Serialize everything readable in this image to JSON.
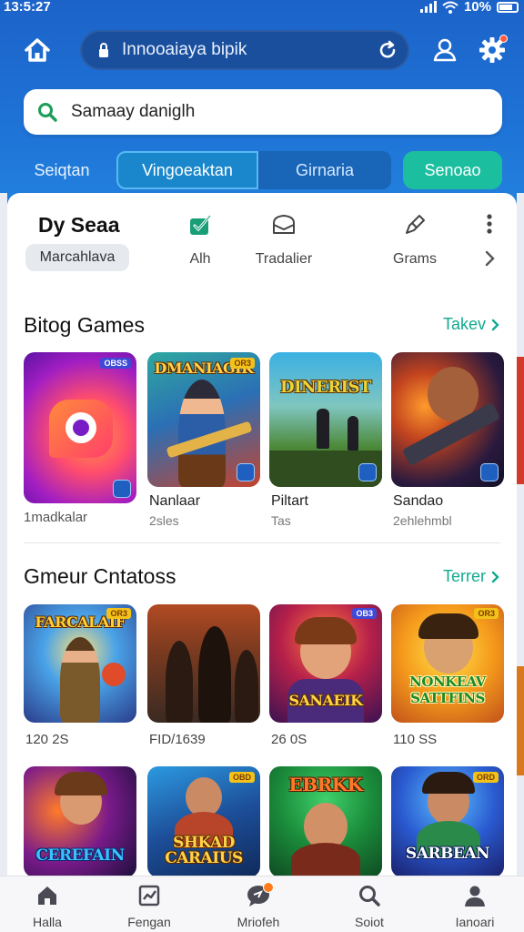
{
  "status": {
    "time": "13:5:27",
    "battery": "10%"
  },
  "header": {
    "url": "Innooaiaya bipik",
    "search_text": "Samaay daniglh",
    "tabs": [
      "Seiqtan",
      "Vingoeaktan",
      "Girnaria",
      "Senoao"
    ]
  },
  "categories": {
    "title": "Dy Seaa",
    "chip": "Marcahlava",
    "items": [
      {
        "label": "Alh",
        "icon": "verified-leaf-icon"
      },
      {
        "label": "Tradalier",
        "icon": "wallet-icon"
      },
      {
        "label": "Grams",
        "icon": "pen-icon"
      }
    ]
  },
  "section1": {
    "title": "Bitog Games",
    "link": "Takev",
    "cards": [
      {
        "art": "",
        "tag": "OBSS",
        "name": "",
        "sub": "1madkalar"
      },
      {
        "art": "DMANIAGIK",
        "tag": "OR3",
        "name": "Nanlaar",
        "sub": "2sles"
      },
      {
        "art": "DINERIST",
        "tag": "",
        "name": "Piltart",
        "sub": "Tas"
      },
      {
        "art": "",
        "tag": "",
        "name": "Sandao",
        "sub": "2ehlehmbl"
      }
    ]
  },
  "section2": {
    "title": "Gmeur Cntatoss",
    "link": "Terrer",
    "cards": [
      {
        "art": "FARCALAIF",
        "tag": "OR3",
        "sub": "120 2S"
      },
      {
        "art": "",
        "tag": "",
        "sub": "FID/1639"
      },
      {
        "art": "SANAEIK",
        "tag": "OB3",
        "sub": "26 0S"
      },
      {
        "art": "NONKEAV SATTFINS",
        "tag": "OR3",
        "sub": "110 SS"
      }
    ]
  },
  "section3": {
    "cards": [
      {
        "art": "CEREFAIN",
        "tag": ""
      },
      {
        "art": "SHKAD CARAIUS",
        "tag": "OBD"
      },
      {
        "art": "EBRKK",
        "tag": ""
      },
      {
        "art": "SARBEAN",
        "tag": "ORD"
      }
    ]
  },
  "nav": [
    {
      "label": "Halla",
      "icon": "home-icon"
    },
    {
      "label": "Fengan",
      "icon": "chart-icon"
    },
    {
      "label": "Mriofeh",
      "icon": "chat-icon"
    },
    {
      "label": "Soiot",
      "icon": "search-icon"
    },
    {
      "label": "Ianoari",
      "icon": "profile-icon"
    }
  ],
  "colors": {
    "header": "#1e72d6",
    "accent": "#13a990",
    "active_tab": "#1a87cc",
    "cta": "#1bbf9f"
  }
}
